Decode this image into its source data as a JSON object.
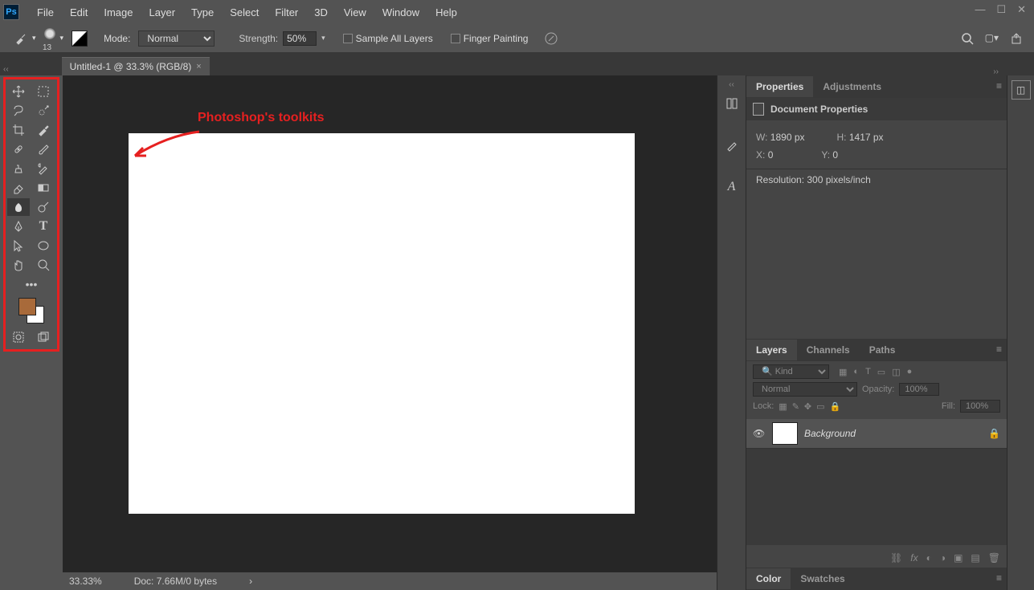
{
  "menus": [
    "File",
    "Edit",
    "Image",
    "Layer",
    "Type",
    "Select",
    "Filter",
    "3D",
    "View",
    "Window",
    "Help"
  ],
  "options": {
    "brush_size": "13",
    "mode_label": "Mode:",
    "mode_value": "Normal",
    "strength_label": "Strength:",
    "strength_value": "50%",
    "sample_all": "Sample All Layers",
    "finger_paint": "Finger Painting"
  },
  "doc_tab": "Untitled-1 @ 33.3% (RGB/8)",
  "annotation": "Photoshop's toolkits",
  "properties": {
    "tab1": "Properties",
    "tab2": "Adjustments",
    "header": "Document Properties",
    "w_label": "W:",
    "w_value": "1890 px",
    "h_label": "H:",
    "h_value": "1417 px",
    "x_label": "X:",
    "x_value": "0",
    "y_label": "Y:",
    "y_value": "0",
    "resolution": "Resolution: 300 pixels/inch"
  },
  "layers": {
    "tab1": "Layers",
    "tab2": "Channels",
    "tab3": "Paths",
    "filter_kind": "Kind",
    "blend": "Normal",
    "opacity_label": "Opacity:",
    "opacity_value": "100%",
    "lock_label": "Lock:",
    "fill_label": "Fill:",
    "fill_value": "100%",
    "layer_name": "Background"
  },
  "colors_tab1": "Color",
  "colors_tab2": "Swatches",
  "status": {
    "zoom": "33.33%",
    "doc_info": "Doc: 7.66M/0 bytes"
  }
}
